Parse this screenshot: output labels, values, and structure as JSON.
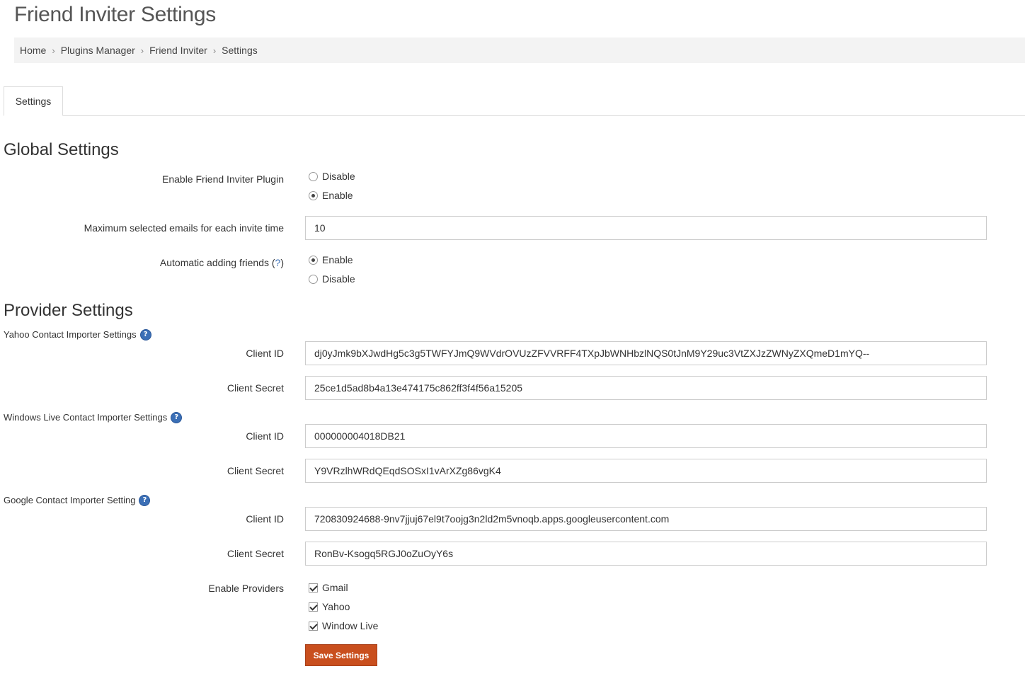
{
  "page": {
    "title": "Friend Inviter Settings"
  },
  "breadcrumb": [
    "Home",
    "Plugins Manager",
    "Friend Inviter",
    "Settings"
  ],
  "tabs": [
    {
      "label": "Settings",
      "active": true
    }
  ],
  "global": {
    "heading": "Global Settings",
    "enable_plugin": {
      "label": "Enable Friend Inviter Plugin",
      "options": [
        {
          "label": "Disable",
          "checked": false
        },
        {
          "label": "Enable",
          "checked": true
        }
      ]
    },
    "max_emails": {
      "label": "Maximum selected emails for each invite time",
      "value": "10"
    },
    "auto_add": {
      "label": "Automatic adding friends (",
      "help": "?",
      "suffix": ")",
      "options": [
        {
          "label": "Enable",
          "checked": true
        },
        {
          "label": "Disable",
          "checked": false
        }
      ]
    }
  },
  "providers": {
    "heading": "Provider Settings",
    "yahoo": {
      "title": "Yahoo Contact Importer Settings",
      "client_id_label": "Client ID",
      "client_id": "dj0yJmk9bXJwdHg5c3g5TWFYJmQ9WVdrOVUzZFVVRFF4TXpJbWNHbzlNQS0tJnM9Y29uc3VtZXJzZWNyZXQmeD1mYQ--",
      "client_secret_label": "Client Secret",
      "client_secret": "25ce1d5ad8b4a13e474175c862ff3f4f56a15205"
    },
    "windows": {
      "title": "Windows Live Contact Importer Settings",
      "client_id_label": "Client ID",
      "client_id": "000000004018DB21",
      "client_secret_label": "Client Secret",
      "client_secret": "Y9VRzlhWRdQEqdSOSxI1vArXZg86vgK4"
    },
    "google": {
      "title": "Google Contact Importer Setting",
      "client_id_label": "Client ID",
      "client_id": "720830924688-9nv7jjuj67el9t7oojg3n2ld2m5vnoqb.apps.googleusercontent.com",
      "client_secret_label": "Client Secret",
      "client_secret": "RonBv-Ksogq5RGJ0oZuOyY6s"
    },
    "enable_providers": {
      "label": "Enable Providers",
      "options": [
        {
          "label": "Gmail",
          "checked": true
        },
        {
          "label": "Yahoo",
          "checked": true
        },
        {
          "label": "Window Live",
          "checked": true
        }
      ]
    }
  },
  "help_icon_glyph": "?",
  "save_label": "Save Settings",
  "colors": {
    "save_button": "#c94f1e",
    "help_icon": "#3b6fb6",
    "breadcrumb_bg": "#f3f3f3"
  }
}
